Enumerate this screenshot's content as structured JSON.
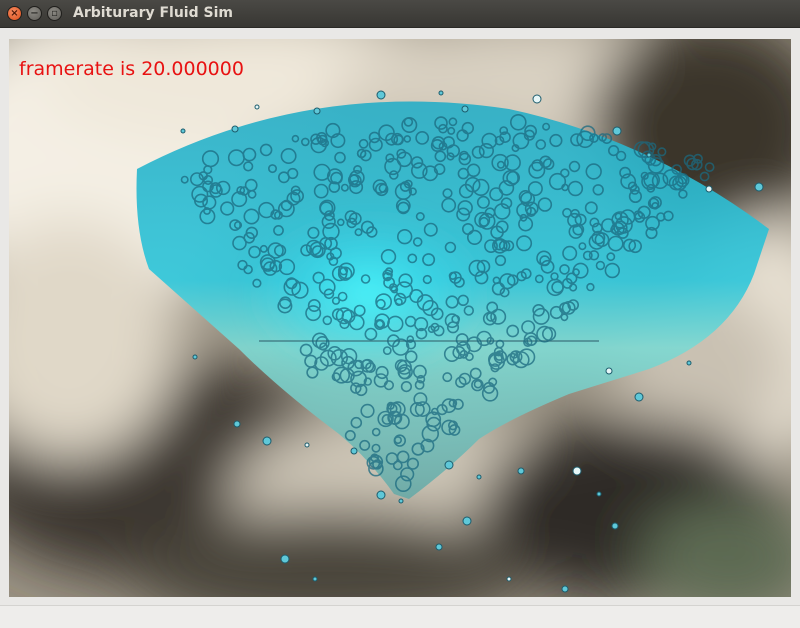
{
  "window": {
    "title": "Arbiturary Fluid Sim",
    "buttons": {
      "close": "×",
      "minimize": "−",
      "maximize": "▫"
    }
  },
  "viewport": {
    "overlay_text": "framerate is 20.000000",
    "overlay_color": "#e81212",
    "fluid_color": "#2fc4d8",
    "fluid_core_color": "#36f2ff",
    "sky_light_color": "#f6f1e6",
    "sky_dark_color": "#2a2620"
  }
}
